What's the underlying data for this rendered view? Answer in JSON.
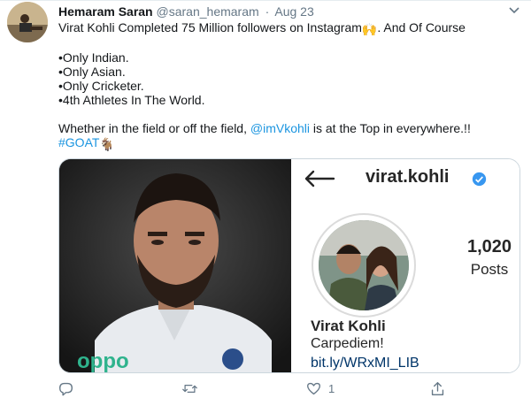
{
  "tweet": {
    "author_name": "Hemaram Saran",
    "author_handle": "@saran_hemaram",
    "separator": "·",
    "date": "Aug 23",
    "line1": "Virat Kohli Completed 75 Million followers on Instagram",
    "line1_emoji": "🙌",
    "line1_end": ". And Of Course",
    "bullets": [
      "•Only Indian.",
      "•Only Asian.",
      "•Only Cricketer.",
      "•4th Athletes In The World."
    ],
    "closing_pre": "Whether in the field or off the field, ",
    "mention": "@imVkohli",
    "closing_post": " is at the Top in everywhere.!!",
    "hashtag": "#GOAT",
    "hashtag_emoji": "🐐"
  },
  "instagram": {
    "username": "virat.kohli",
    "posts_count": "1,020",
    "posts_label": "Posts",
    "full_name": "Virat Kohli",
    "bio": "Carpediem!",
    "link": "bit.ly/WRxMI_LIB"
  },
  "actions": {
    "reply_icon": "reply-icon",
    "retweet_icon": "retweet-icon",
    "like_icon": "like-icon",
    "like_count": "1",
    "share_icon": "share-icon"
  },
  "colors": {
    "link_blue": "#1b95e0",
    "muted_gray": "#657786",
    "verified_blue": "#3897f0"
  }
}
